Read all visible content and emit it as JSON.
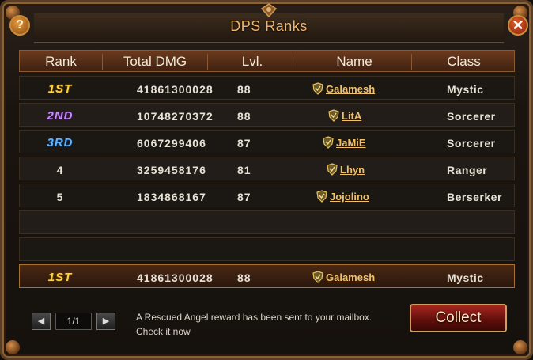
{
  "window": {
    "title": "DPS Ranks",
    "help_label": "?",
    "close_label": "✕"
  },
  "table": {
    "columns": [
      "Rank",
      "Total DMG",
      "Lvl.",
      "Name",
      "Class"
    ],
    "rows": [
      {
        "rank": "1ST",
        "rank_color": "#ffd23a",
        "dmg": "41861300028",
        "lvl": "88",
        "name": "Galamesh",
        "cls": "Mystic"
      },
      {
        "rank": "2ND",
        "rank_color": "#c98bff",
        "dmg": "10748270372",
        "lvl": "88",
        "name": "LitA",
        "cls": "Sorcerer"
      },
      {
        "rank": "3RD",
        "rank_color": "#5fb6ff",
        "dmg": "6067299406",
        "lvl": "87",
        "name": "JaMiE",
        "cls": "Sorcerer"
      },
      {
        "rank": "4",
        "dmg": "3259458176",
        "lvl": "81",
        "name": "Lhyn",
        "cls": "Ranger"
      },
      {
        "rank": "5",
        "dmg": "1834868167",
        "lvl": "87",
        "name": "Jojolino",
        "cls": "Berserker"
      }
    ]
  },
  "self": {
    "rank": "1ST",
    "dmg": "41861300028",
    "lvl": "88",
    "name": "Galamesh",
    "cls": "Mystic"
  },
  "pager": {
    "page": "1/1",
    "prev_icon": "arrow-left-icon",
    "next_icon": "arrow-right-icon"
  },
  "notice": "A Rescued Angel reward has been sent to your mailbox. Check it now",
  "collect_label": "Collect",
  "colors": {
    "accent": "#f0b46a",
    "header": "#6b3a1d",
    "collect": "#a3271e"
  }
}
